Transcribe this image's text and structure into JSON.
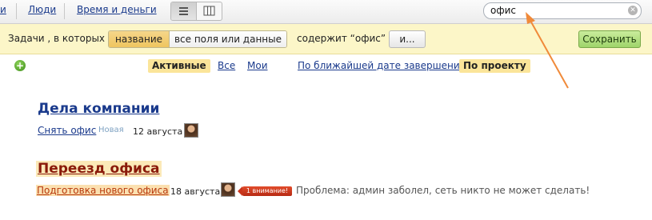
{
  "nav": {
    "item_cut": "и",
    "people": "Люди",
    "time_money": "Время и деньги"
  },
  "search": {
    "value": "офис",
    "clear_icon": "close-circle-icon"
  },
  "filter": {
    "prefix": "Задачи , в которых",
    "option_selected": "название",
    "option_other": "все поля или данные",
    "contains": "содержит “офис”",
    "more_button": "и...",
    "save_button": "Сохранить"
  },
  "sort": {
    "add_icon": "+",
    "active": "Активные",
    "all": "Все",
    "mine": "Мои",
    "by_date": "По ближайшей дате завершения",
    "by_project": "По проекту"
  },
  "projects": [
    {
      "title": "Дела компании",
      "task": "Снять офис",
      "status": "Новая",
      "date": "12 августа"
    },
    {
      "title": "Переезд офиса",
      "task": "Подготовка нового офиса",
      "date": "18 августа",
      "badge": "1 внимание!",
      "note": "Проблема: админ заболел, сеть никто не может сделать!"
    }
  ],
  "colors": {
    "accent_link": "#1a3a8c",
    "highlight": "#fbe59a",
    "save_green": "#9fd46a",
    "arrow": "#f08a3a"
  }
}
